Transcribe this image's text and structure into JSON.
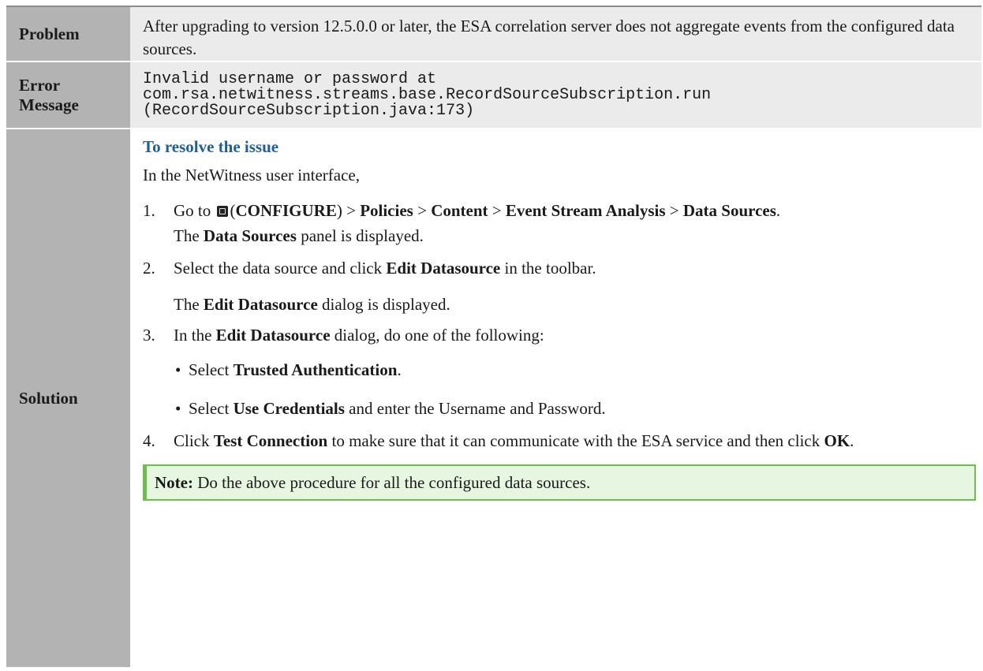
{
  "rows": {
    "problem": {
      "label": "Problem",
      "text": "After upgrading to version 12.5.0.0 or later, the ESA correlation server does not aggregate events from the configured data sources."
    },
    "error": {
      "label_line1": "Error",
      "label_line2": "Message",
      "line1": "Invalid username or password at",
      "line2": "com.rsa.netwitness.streams.base.RecordSourceSubscription.run",
      "line3": "(RecordSourceSubscription.java:173)"
    },
    "solution": {
      "label": "Solution",
      "heading": "To resolve the issue",
      "intro": "In the NetWitness user interface,",
      "steps": [
        {
          "num": "1.",
          "go_to": "Go to",
          "configure": "CONFIGURE",
          "sep": ">",
          "policies": "Policies",
          "content": "Content",
          "esa": "Event Stream Analysis",
          "data_sources": "Data Sources",
          "result_pre": "The",
          "result_bold": "Data Sources",
          "result_post": "panel is displayed."
        },
        {
          "num": "2.",
          "text_pre": "Select the data source and click",
          "text_bold": "Edit Datasource",
          "text_post": "in the toolbar.",
          "result_pre": "The",
          "result_bold": "Edit Datasource",
          "result_post": "dialog is displayed."
        },
        {
          "num": "3.",
          "text_pre": "In the",
          "text_bold": "Edit Datasource",
          "text_post": "dialog, do one of the following:",
          "options": [
            {
              "pre": "Select",
              "bold": "Trusted Authentication",
              "post": "."
            },
            {
              "pre": "Select",
              "bold": "Use Credentials",
              "post": "and enter the Username and Password."
            }
          ]
        },
        {
          "num": "4.",
          "text_pre": "Click",
          "text_bold": "Test Connection",
          "text_mid": "to make sure that it can communicate with the ESA service and then click",
          "text_bold2": "OK",
          "text_post": "."
        }
      ],
      "note": {
        "label": "Note:",
        "text": "Do the above procedure for all the configured data sources."
      }
    }
  },
  "icons": {
    "configure": "configure-icon"
  },
  "colors": {
    "label_bg": "#b3b3b3",
    "content_bg": "#ebebeb",
    "heading": "#1f5f99",
    "note_bg": "#e6f6e0",
    "note_border": "#6cc04a"
  }
}
